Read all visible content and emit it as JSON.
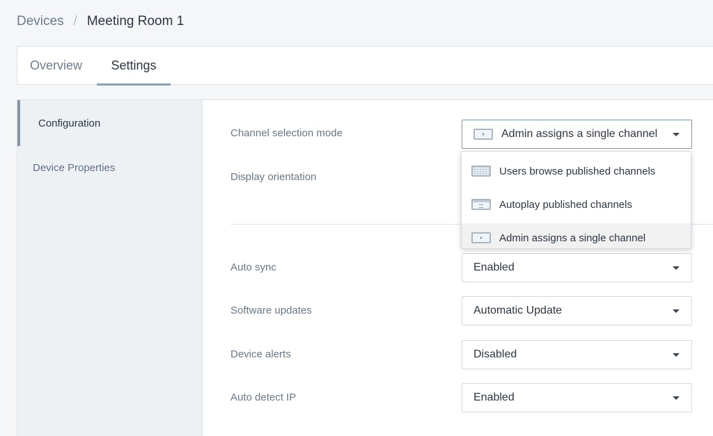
{
  "breadcrumb": {
    "parent": "Devices",
    "separator": "/",
    "current": "Meeting Room 1"
  },
  "tabs": [
    {
      "label": "Overview",
      "active": false
    },
    {
      "label": "Settings",
      "active": true
    }
  ],
  "sidebar": {
    "items": [
      {
        "label": "Configuration",
        "active": true
      },
      {
        "label": "Device Properties",
        "active": false
      }
    ]
  },
  "settings": {
    "channel_mode": {
      "label": "Channel selection mode",
      "value": "Admin assigns a single channel",
      "icon": "single-channel-icon",
      "open": true,
      "options": [
        {
          "label": "Users browse published channels",
          "icon": "browse-channels-icon"
        },
        {
          "label": "Autoplay published channels",
          "icon": "autoplay-channels-icon"
        },
        {
          "label": "Admin assigns a single channel",
          "icon": "single-channel-icon",
          "selected": true
        }
      ]
    },
    "display_orientation": {
      "label": "Display orientation"
    },
    "auto_sync": {
      "label": "Auto sync",
      "value": "Enabled"
    },
    "software_updates": {
      "label": "Software updates",
      "value": "Automatic Update"
    },
    "device_alerts": {
      "label": "Device alerts",
      "value": "Disabled"
    },
    "auto_detect_ip": {
      "label": "Auto detect IP",
      "value": "Enabled"
    }
  },
  "colors": {
    "background": "#f5f6f8",
    "accent": "#8495a7",
    "active_border": "#7b95b2",
    "text": "#2b3640",
    "muted_text": "#667788"
  }
}
